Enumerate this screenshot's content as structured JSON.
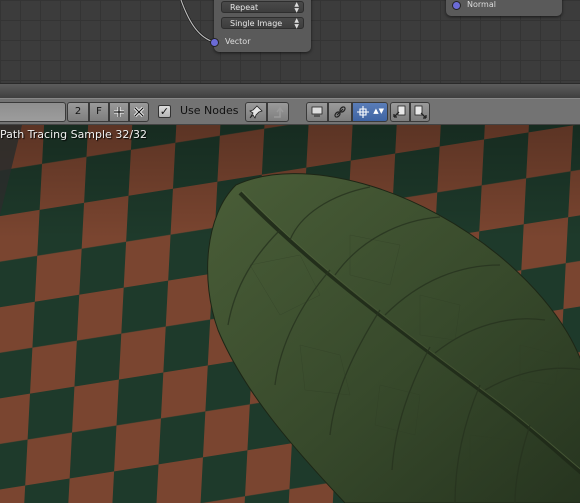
{
  "node_editor": {
    "image_node": {
      "extension_value": "Repeat",
      "projection_value": "Single Image",
      "vector_input_label": "Vector"
    },
    "output_node": {
      "normal_input_label": "Normal"
    }
  },
  "toolbar": {
    "name_value": "",
    "users_count": "2",
    "fake_user_label": "F",
    "use_nodes_label": "Use Nodes",
    "use_nodes_checked": true
  },
  "viewport": {
    "status_text": "Path Tracing Sample 32/32"
  },
  "colors": {
    "checker_brown": "#7a4530",
    "checker_green": "#1e3a2b",
    "leaf_green": "#3f5330",
    "socket_vector": "#6b6bd6",
    "toggle_active": "#5a7db8"
  }
}
